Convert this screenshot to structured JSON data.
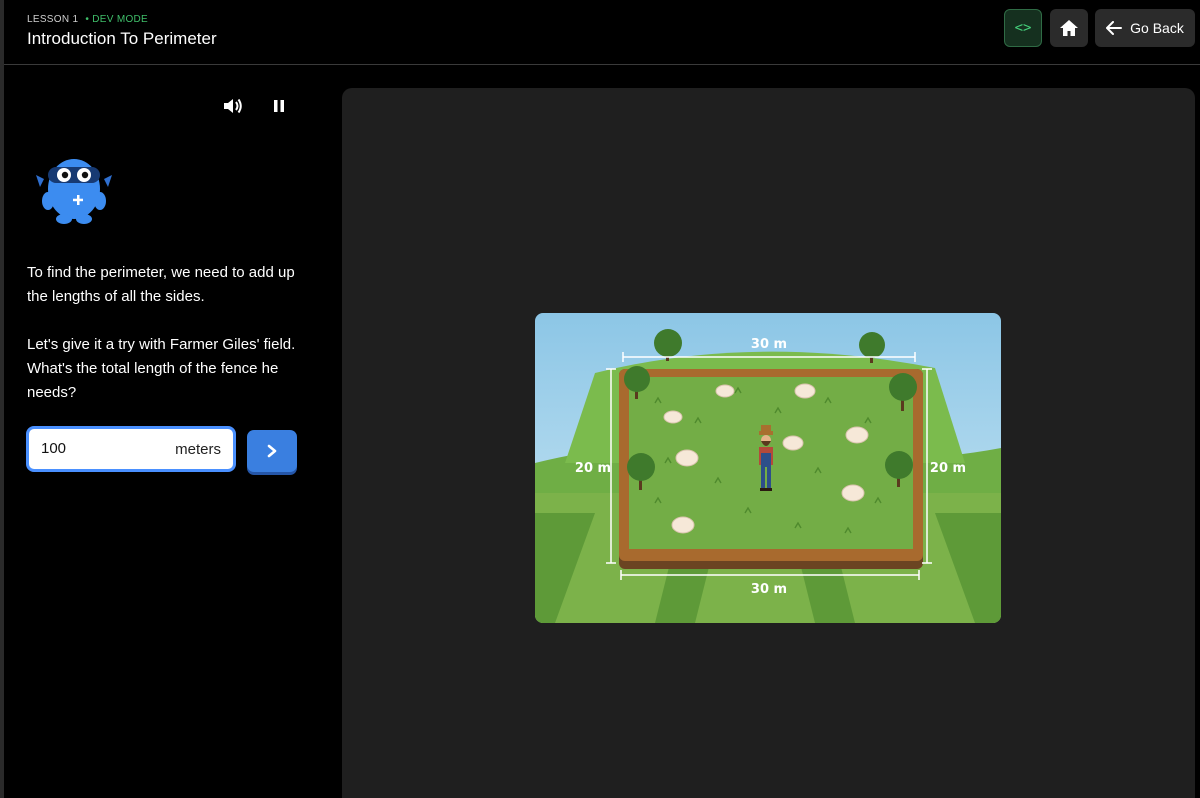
{
  "header": {
    "lesson_label": "LESSON 1",
    "dev_mode_label": "• DEV MODE",
    "title": "Introduction To Perimeter",
    "back_label": "Go Back"
  },
  "icons": {
    "code": "code-icon",
    "home": "home-icon",
    "back": "arrow-left-icon",
    "volume": "volume-icon",
    "pause": "pause-icon",
    "mascot": "ninja-mascot",
    "submit": "chevron-right-icon"
  },
  "instructions": {
    "paragraph1": "To find the perimeter, we need to add up the lengths of all the sides.",
    "paragraph2": "Let's give it a try with Farmer Giles' field. What's the total length of the fence he needs?"
  },
  "answer": {
    "value": "100",
    "unit": "meters"
  },
  "illustration": {
    "top_label": "30 m",
    "bottom_label": "30 m",
    "left_label": "20 m",
    "right_label": "20 m"
  },
  "colors": {
    "accent": "#3a7fe0",
    "dev_mode": "#3fbf6a",
    "input_border": "#4a90ff"
  }
}
